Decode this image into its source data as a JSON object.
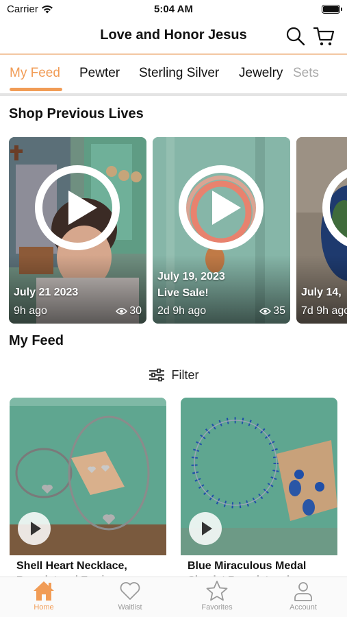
{
  "status_bar": {
    "carrier": "Carrier",
    "time": "5:04 AM"
  },
  "header": {
    "title": "Love and Honor Jesus",
    "search_icon": "search-icon",
    "cart_icon": "cart-icon"
  },
  "tabs": [
    {
      "label": "My Feed",
      "active": true
    },
    {
      "label": "Pewter",
      "active": false
    },
    {
      "label": "Sterling Silver",
      "active": false
    },
    {
      "label": "Jewelry",
      "active": false
    },
    {
      "label": "Sets",
      "active": false
    }
  ],
  "lives_section": {
    "title": "Shop Previous Lives",
    "items": [
      {
        "date": "July 21 2023",
        "subtitle": "",
        "ago": "9h ago",
        "views": "30"
      },
      {
        "date": "July 19, 2023",
        "subtitle": "Live Sale!",
        "ago": "2d 9h ago",
        "views": "35"
      },
      {
        "date": "July 14,",
        "subtitle": "",
        "ago": "7d 9h ago",
        "views": ""
      }
    ]
  },
  "feed_section": {
    "title": "My Feed",
    "filter_label": "Filter",
    "items": [
      {
        "title": "Shell Heart Necklace,",
        "subtitle": "Bracelet and Earrings"
      },
      {
        "title": "Blue Miraculous Medal",
        "subtitle": "Chaplet Bracelet and"
      }
    ]
  },
  "bottom_nav": [
    {
      "label": "Home",
      "icon": "home-icon",
      "active": true
    },
    {
      "label": "Waitlist",
      "icon": "heart-icon",
      "active": false
    },
    {
      "label": "Favorites",
      "icon": "star-icon",
      "active": false
    },
    {
      "label": "Account",
      "icon": "person-icon",
      "active": false
    }
  ],
  "colors": {
    "accent": "#f19c56",
    "inactive": "#9a9a9a",
    "divider": "#f3c7a2"
  }
}
